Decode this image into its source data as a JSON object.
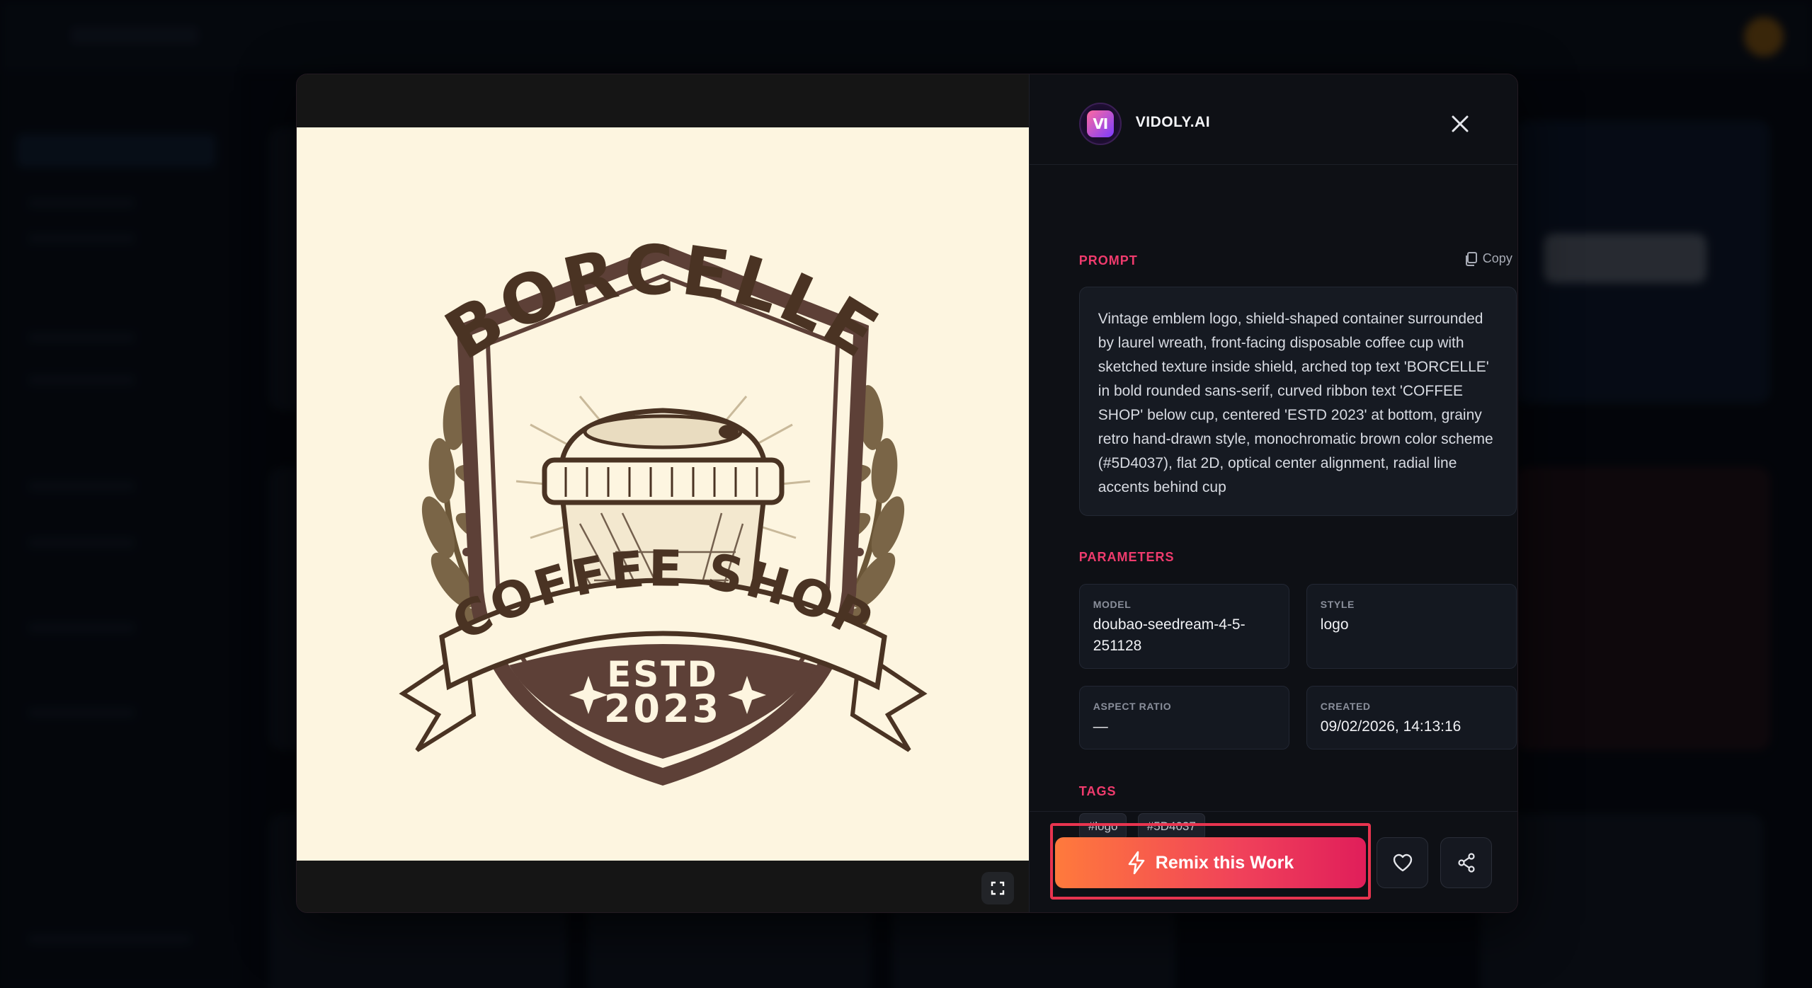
{
  "modal": {
    "brand_name": "VIDOLY.AI",
    "brand_badge": "VI",
    "prompt_label": "PROMPT",
    "copy_label": "Copy",
    "prompt_text": "Vintage emblem logo, shield-shaped container surrounded by laurel wreath, front-facing disposable coffee cup with sketched texture inside shield, arched top text 'BORCELLE' in bold rounded sans-serif, curved ribbon text 'COFFEE SHOP' below cup, centered 'ESTD 2023' at bottom, grainy retro hand-drawn style, monochromatic brown color scheme (#5D4037), flat 2D, optical center alignment, radial line accents behind cup",
    "parameters_label": "PARAMETERS",
    "parameters": {
      "model_label": "MODEL",
      "model_value": "doubao-seedream-4-5-251128",
      "style_label": "STYLE",
      "style_value": "logo",
      "aspect_label": "ASPECT RATIO",
      "aspect_value": "—",
      "created_label": "CREATED",
      "created_value": "09/02/2026, 14:13:16"
    },
    "tags_label": "TAGS",
    "tags": [
      "#logo",
      "#5D4037"
    ],
    "remix_label": "Remix this Work",
    "icons": {
      "close": "close-icon",
      "copy": "copy-icon",
      "fullscreen": "fullscreen-icon",
      "remix": "lightning-icon",
      "like": "heart-icon",
      "share": "share-icon"
    }
  },
  "artwork": {
    "top_text": "BORCELLE",
    "ribbon_text": "COFFEE SHOP",
    "estd_text": "ESTD",
    "year_text": "2023",
    "brown": "#5D4037",
    "cream": "#FDF5E0"
  },
  "colors": {
    "accent": "#EF3B6D",
    "remix_gradient_start": "#FF7A3C",
    "remix_gradient_end": "#E01E5A",
    "modal_bg": "#0D0F14"
  }
}
